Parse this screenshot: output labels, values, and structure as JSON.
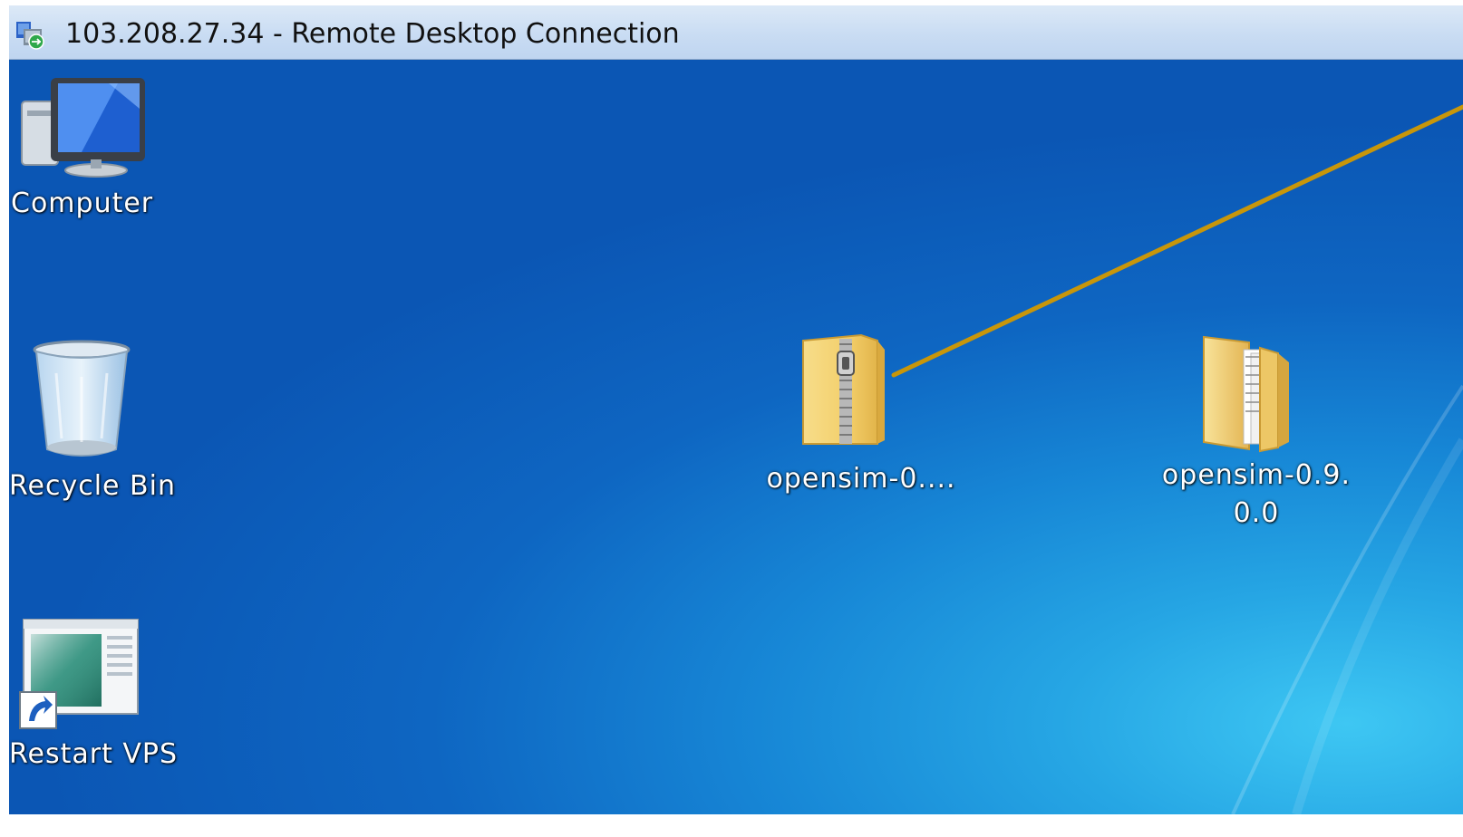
{
  "window": {
    "title": "103.208.27.34 - Remote Desktop Connection"
  },
  "desktop": {
    "icons": [
      {
        "label": "Computer",
        "icon": "computer-icon"
      },
      {
        "label": "Recycle Bin",
        "icon": "recycle-bin-icon"
      },
      {
        "label": "Restart VPS",
        "icon": "shortcut-icon"
      },
      {
        "label": "opensim-0....",
        "icon": "zip-folder-icon"
      },
      {
        "label_line1": "opensim-0.9.",
        "label_line2": "0.0",
        "icon": "folder-icon"
      }
    ]
  },
  "annotation": {
    "arrow_color": "#c8960a"
  }
}
